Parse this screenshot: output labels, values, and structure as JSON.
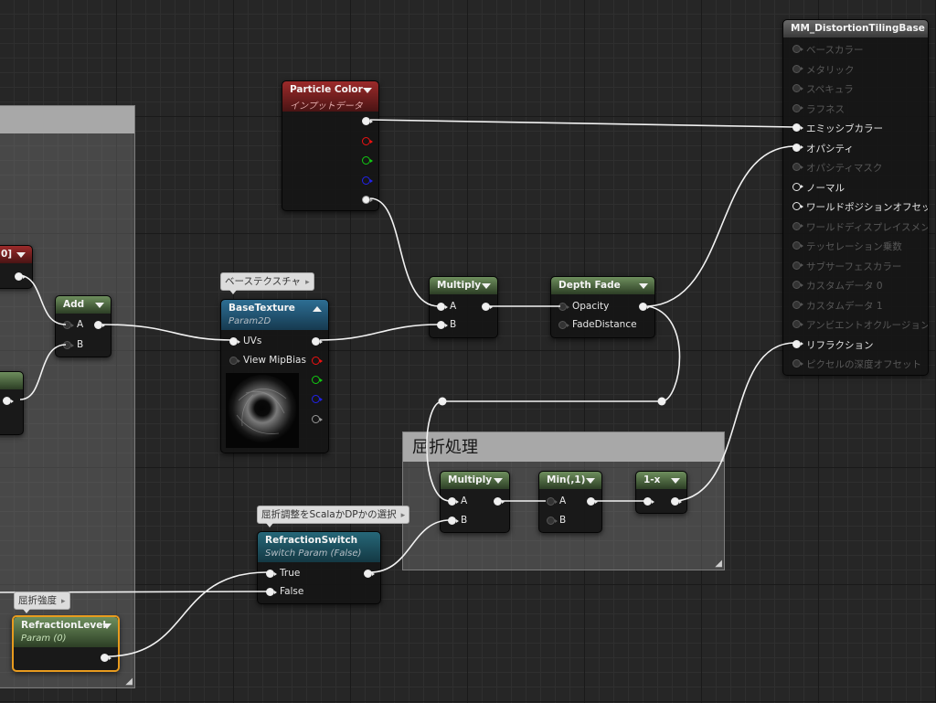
{
  "canvas": {
    "background": "#262626"
  },
  "comments": [
    {
      "id": "left",
      "title": ""
    },
    {
      "id": "refraction",
      "title": "屈折処理"
    }
  ],
  "bubbles": {
    "base_texture": "ベーステクスチャ",
    "switch": "屈折調整をScalaかDPかの選択",
    "strength": "屈折強度"
  },
  "nodes": {
    "partial_param": {
      "title": "0]"
    },
    "add": {
      "title": "Add",
      "pins": [
        "A",
        "B"
      ]
    },
    "particle_color": {
      "title": "Particle Color",
      "subtitle": "インプットデータ"
    },
    "base_texture": {
      "title": "BaseTexture",
      "subtitle": "Param2D",
      "pins": [
        "UVs",
        "View MipBias"
      ]
    },
    "multiply_top": {
      "title": "Multiply",
      "pins": [
        "A",
        "B"
      ]
    },
    "depth_fade": {
      "title": "Depth Fade",
      "pins": [
        "Opacity",
        "FadeDistance"
      ]
    },
    "multiply_refr": {
      "title": "Multiply",
      "pins": [
        "A",
        "B"
      ]
    },
    "min": {
      "title": "Min(,1)",
      "pins": [
        "A",
        "B"
      ]
    },
    "one_minus_x": {
      "title": "1-x"
    },
    "refraction_switch": {
      "title": "RefractionSwitch",
      "subtitle": "Switch Param (False)",
      "pins": [
        "True",
        "False"
      ]
    },
    "refraction_level": {
      "title": "RefractionLevel",
      "subtitle": "Param (0)"
    }
  },
  "material": {
    "title": "MM_DistortionTilingBase",
    "pins": [
      {
        "label": "ベースカラー",
        "active": false
      },
      {
        "label": "メタリック",
        "active": false
      },
      {
        "label": "スペキュラ",
        "active": false
      },
      {
        "label": "ラフネス",
        "active": false
      },
      {
        "label": "エミッシブカラー",
        "active": true,
        "connected": true
      },
      {
        "label": "オパシティ",
        "active": true,
        "connected": true
      },
      {
        "label": "オパシティマスク",
        "active": false
      },
      {
        "label": "ノーマル",
        "active": true,
        "connected": false
      },
      {
        "label": "ワールドポジションオフセット",
        "active": true,
        "connected": false
      },
      {
        "label": "ワールドディスプレイスメント",
        "active": false
      },
      {
        "label": "テッセレーション乗数",
        "active": false
      },
      {
        "label": "サブサーフェスカラー",
        "active": false
      },
      {
        "label": "カスタムデータ 0",
        "active": false
      },
      {
        "label": "カスタムデータ 1",
        "active": false
      },
      {
        "label": "アンビエントオクルージョン",
        "active": false
      },
      {
        "label": "リフラクション",
        "active": true,
        "connected": true
      },
      {
        "label": "ピクセルの深度オフセット",
        "active": false
      }
    ]
  }
}
